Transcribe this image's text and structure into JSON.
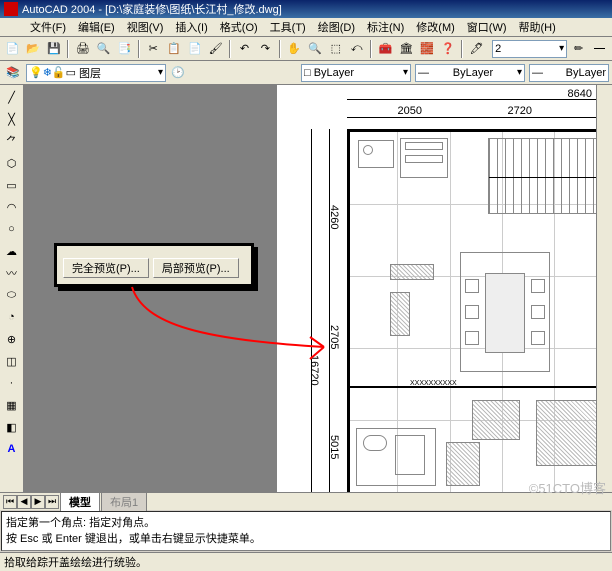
{
  "title": "AutoCAD 2004 - [D:\\家庭装修\\图纸\\长江村_修改.dwg]",
  "menu": [
    "文件(F)",
    "编辑(E)",
    "视图(V)",
    "插入(I)",
    "格式(O)",
    "工具(T)",
    "绘图(D)",
    "标注(N)",
    "修改(M)",
    "窗口(W)",
    "帮助(H)"
  ],
  "layer_label": "图层",
  "props": {
    "box1": "□ ByLayer",
    "box2": "ByLayer",
    "box3": "ByLayer"
  },
  "lineweight_value": "2",
  "popup": {
    "btn1": "完全预览(P)...",
    "btn2": "局部预览(P)..."
  },
  "tabs": {
    "active": "模型",
    "inactive": "布局1"
  },
  "cmd1": "指定第一个角点: 指定对角点。",
  "cmd2": "按 Esc 或 Enter 键退出，或单击右键显示快捷菜单。",
  "status_hint": "拾取给踪开盖绘绘进行统验。",
  "dims": {
    "top_total": "8640",
    "top_left": "2050",
    "top_right": "2720",
    "v1": "4260",
    "v2": "2705",
    "v3": "5015",
    "side_total": "16720"
  },
  "watermark": "©51CTO博客"
}
